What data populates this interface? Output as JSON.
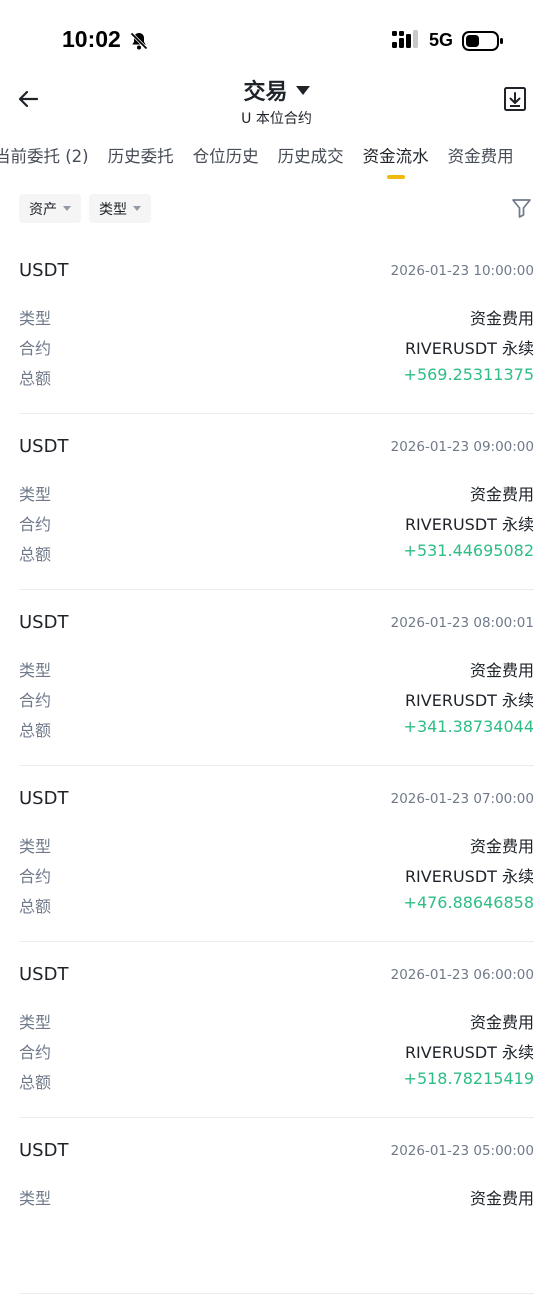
{
  "status_bar": {
    "time": "10:02",
    "network": "5G",
    "icons": [
      "bell-slash-icon",
      "signal-icon",
      "battery-icon"
    ]
  },
  "header": {
    "title": "交易",
    "subtitle": "U 本位合约",
    "icons": [
      "back-arrow-icon",
      "caret-down-icon",
      "download-icon"
    ]
  },
  "tabs": [
    {
      "label": "当前委托 (2)",
      "active": false
    },
    {
      "label": "历史委托",
      "active": false
    },
    {
      "label": "仓位历史",
      "active": false
    },
    {
      "label": "历史成交",
      "active": false
    },
    {
      "label": "资金流水",
      "active": true
    },
    {
      "label": "资金费用",
      "active": false
    }
  ],
  "filters": {
    "asset_label": "资产",
    "type_label": "类型",
    "filter_icon": "funnel-icon"
  },
  "field_labels": {
    "type": "类型",
    "contract": "合约",
    "amount": "总额"
  },
  "records": [
    {
      "asset": "USDT",
      "time": "2026-01-23 10:00:00",
      "type": "资金费用",
      "contract": "RIVERUSDT 永续",
      "amount": "+569.25311375"
    },
    {
      "asset": "USDT",
      "time": "2026-01-23 09:00:00",
      "type": "资金费用",
      "contract": "RIVERUSDT 永续",
      "amount": "+531.44695082"
    },
    {
      "asset": "USDT",
      "time": "2026-01-23 08:00:01",
      "type": "资金费用",
      "contract": "RIVERUSDT 永续",
      "amount": "+341.38734044"
    },
    {
      "asset": "USDT",
      "time": "2026-01-23 07:00:00",
      "type": "资金费用",
      "contract": "RIVERUSDT 永续",
      "amount": "+476.88646858"
    },
    {
      "asset": "USDT",
      "time": "2026-01-23 06:00:00",
      "type": "资金费用",
      "contract": "RIVERUSDT 永续",
      "amount": "+518.78215419"
    },
    {
      "asset": "USDT",
      "time": "2026-01-23 05:00:00",
      "type": "资金费用",
      "contract": "",
      "amount": ""
    }
  ],
  "colors": {
    "accent": "#f0b90b",
    "positive": "#2ebd85",
    "text_primary": "#1e2329",
    "text_secondary": "#707a8a"
  }
}
